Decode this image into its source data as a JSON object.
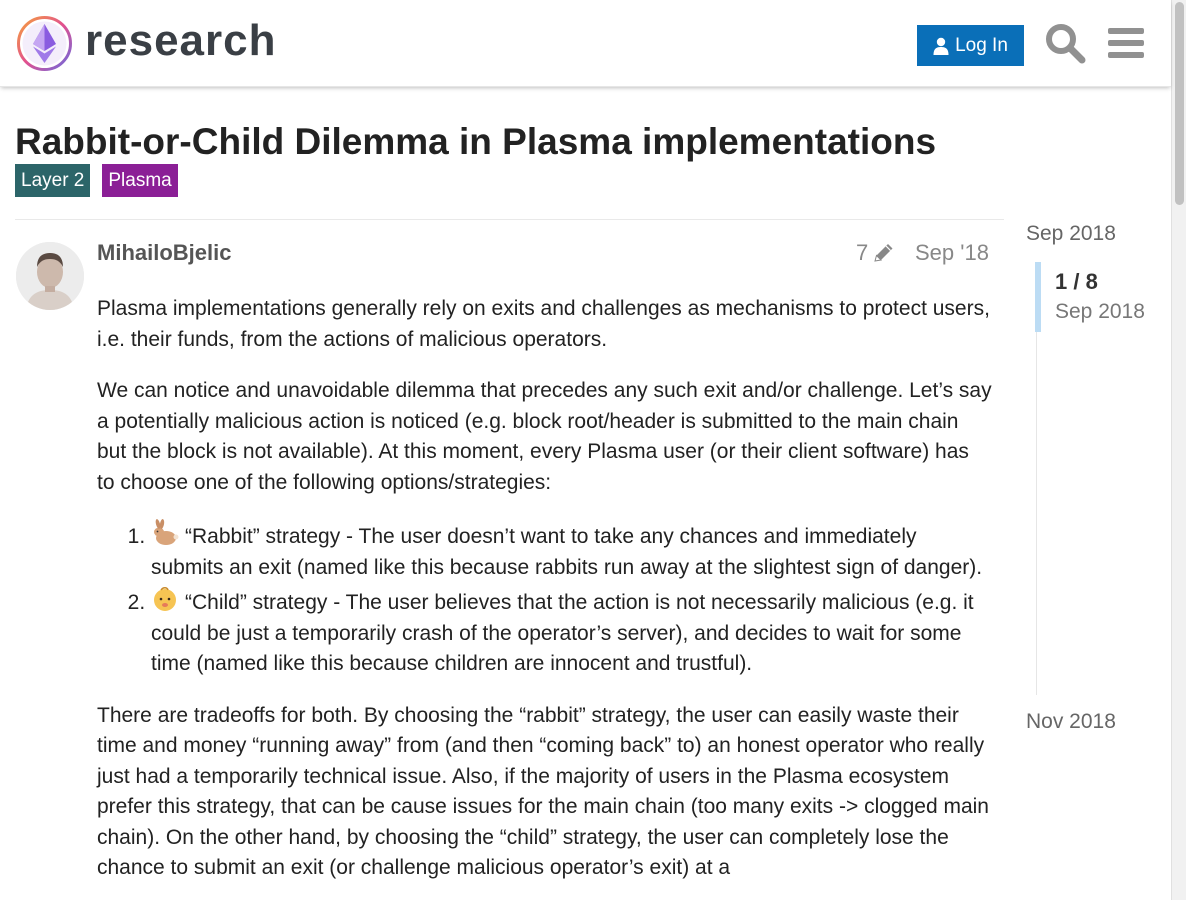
{
  "header": {
    "logo_text": "research",
    "login_label": "Log In",
    "icons": [
      "search-icon",
      "hamburger-menu-icon"
    ]
  },
  "topic": {
    "title": "Rabbit-or-Child Dilemma in Plasma implementations",
    "tags": [
      {
        "label": "Layer 2",
        "color": "#2c6569"
      },
      {
        "label": "Plasma",
        "color": "#8b1f96"
      }
    ]
  },
  "post": {
    "username": "MihailoBjelic",
    "edit_count": "7",
    "date": "Sep '18",
    "paragraphs": [
      "Plasma implementations generally rely on exits and challenges as mechanisms to protect users, i.e. their funds, from the actions of malicious operators.",
      "We can notice and unavoidable dilemma that precedes any such exit and/or challenge. Let’s say a potentially malicious action is noticed (e.g. block root/header is submitted to the main chain but the block is not available). At this moment, every Plasma user (or their client software) has to choose one of the following options/strategies:",
      "There are tradeoffs for both. By choosing the “rabbit” strategy, the user can easily waste their time and money “running away” from (and then “coming back” to) an honest operator who really just had a temporarily technical issue. Also, if the majority of users in the Plasma ecosystem prefer this strategy, that can be cause issues for the main chain (too many exits -> clogged main chain). On the other hand, by choosing the “child” strategy, the user can completely lose the chance to submit an exit (or challenge malicious operator’s exit) at a"
    ],
    "list": [
      {
        "icon": "rabbit-emoji-icon",
        "text": "“Rabbit” strategy - The user doesn’t want to take any chances and immediately submits an exit (named like this because rabbits run away at the slightest sign of danger)."
      },
      {
        "icon": "baby-emoji-icon",
        "text": "“Child” strategy - The user believes that the action is not necessarily malicious (e.g. it could be just a temporarily crash of the operator’s server), and decides to wait for some time (named like this because children are innocent and trustful)."
      }
    ]
  },
  "timeline": {
    "start_date": "Sep 2018",
    "position": "1 / 8",
    "position_date": "Sep 2018",
    "end_date": "Nov 2018"
  },
  "colors": {
    "accent": "#0a6fb8",
    "timeline_handle": "#bcdcf4"
  }
}
